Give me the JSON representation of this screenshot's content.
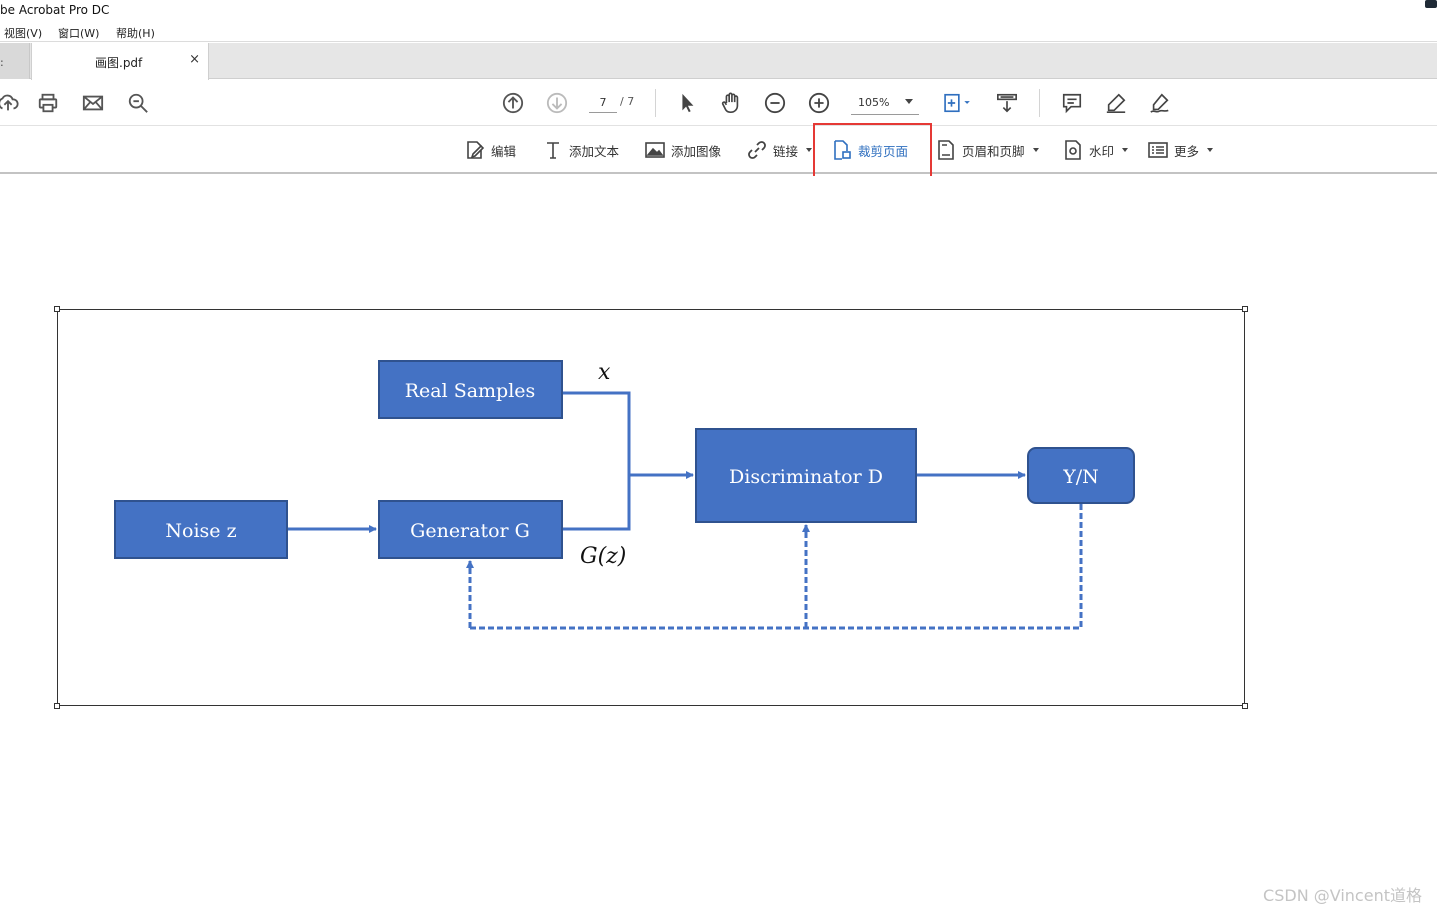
{
  "window": {
    "title": "be Acrobat Pro DC"
  },
  "menu": {
    "items": [
      "视图(V)",
      "窗口(W)",
      "帮助(H)"
    ]
  },
  "tabs": {
    "prev_label": ":",
    "active_label": "画图.pdf",
    "close_glyph": "×"
  },
  "toolbar": {
    "page_current": "7",
    "page_total": "/ 7",
    "zoom": "105%",
    "icons": [
      "upload-icon",
      "print-icon",
      "mail-icon",
      "zoom-search-icon",
      "arrow-up-circle-icon",
      "arrow-down-circle-icon",
      "select-arrow-icon",
      "hand-icon",
      "zoom-out-icon",
      "zoom-in-icon",
      "fit-page-icon",
      "scroll-mode-icon",
      "comment-icon",
      "highlight-pen-icon",
      "sign-icon"
    ]
  },
  "edit_toolbar": {
    "edit": "编辑",
    "add_text": "添加文本",
    "add_image": "添加图像",
    "link": "链接",
    "crop_page": "裁剪页面",
    "header_footer": "页眉和页脚",
    "watermark": "水印",
    "more": "更多"
  },
  "colors": {
    "box_fill": "#4472c4",
    "box_stroke": "#2f528f",
    "arrow": "#4472c4",
    "crop_highlight": "#e53935",
    "crop_text": "#2f6fbf"
  },
  "diagram": {
    "real_samples": "Real Samples",
    "noise": "Noise z",
    "generator": "Generator G",
    "discriminator": "Discriminator D",
    "output": "Y/N",
    "x_label": "x",
    "gz_label": "G(z)"
  },
  "watermark": "CSDN @Vincent道格"
}
